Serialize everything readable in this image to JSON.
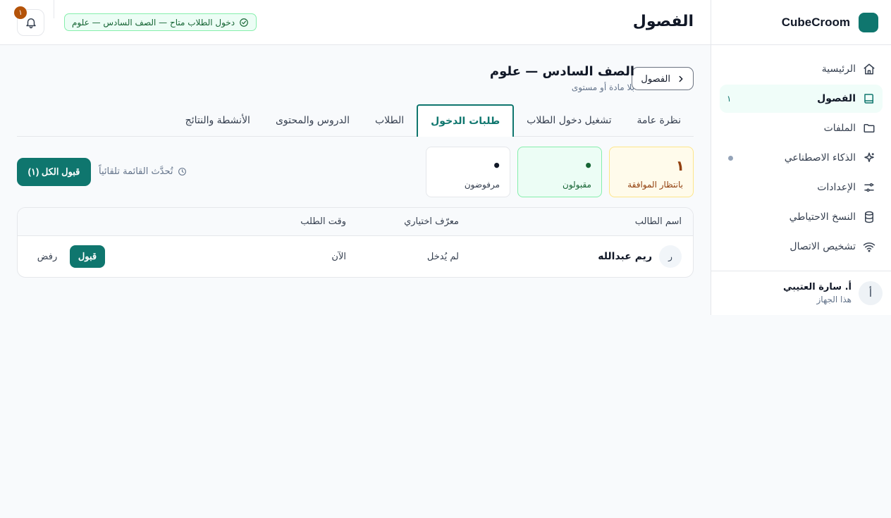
{
  "brand": {
    "name": "CubeCroom",
    "color": "#0f766e"
  },
  "sidebar": {
    "items": [
      {
        "label": "الرئيسية",
        "icon": "home-icon"
      },
      {
        "label": "الفصول",
        "icon": "book-icon",
        "active": true,
        "badge": "١"
      },
      {
        "label": "الملفات",
        "icon": "folder-icon"
      },
      {
        "label": "الذكاء الاصطناعي",
        "icon": "sparkle-icon"
      },
      {
        "label": "الإعدادات",
        "icon": "sliders-icon"
      },
      {
        "label": "النسخ الاحتياطي",
        "icon": "database-icon"
      },
      {
        "label": "تشخيص الاتصال",
        "icon": "wifi-icon"
      }
    ],
    "user": {
      "avatar": "أ",
      "name": "أ. سارة العتيبي",
      "subtitle": "هذا الجهاز"
    }
  },
  "header": {
    "title": "الفصول",
    "status": "دخول الطلاب متاح — الصف السادس — علوم",
    "notifications": "١"
  },
  "class": {
    "back_label": "الفصول",
    "title": "الصف السادس — علوم",
    "subtitle": "بلا مادة أو مستوى"
  },
  "tabs": [
    {
      "label": "نظرة عامة"
    },
    {
      "label": "تشغيل دخول الطلاب"
    },
    {
      "label": "طلبات الدخول",
      "active": true
    },
    {
      "label": "الطلاب"
    },
    {
      "label": "الدروس والمحتوى"
    },
    {
      "label": "الأنشطة والنتائج"
    }
  ],
  "stats": {
    "pending": {
      "value": "١",
      "label": "بانتظار الموافقة"
    },
    "accepted": {
      "value": "•",
      "label": "مقبولون"
    },
    "rejected": {
      "value": "•",
      "label": "مرفوضون"
    }
  },
  "toolbar": {
    "refresh_note": "تُحدَّث القائمة تلقائياً",
    "accept_all": "قبول الكل (١)"
  },
  "table": {
    "columns": [
      "اسم الطالب",
      "معرّف اختياري",
      "وقت الطلب"
    ],
    "rows": [
      {
        "avatar": "ر",
        "name": "ريم عبدالله",
        "id": "لم يُدخل",
        "time": "الآن",
        "accept": "قبول",
        "reject": "رفض"
      }
    ]
  }
}
